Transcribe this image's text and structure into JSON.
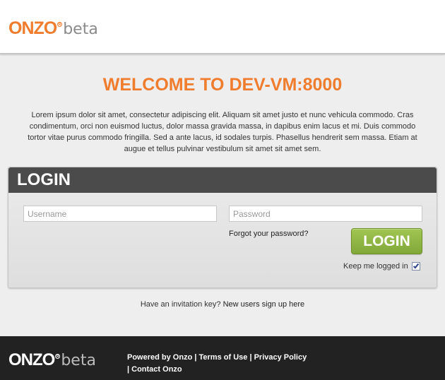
{
  "header": {
    "logo": {
      "brand": "ONZO",
      "reg": "R",
      "beta": "beta"
    }
  },
  "welcome": {
    "title": "WELCOME TO DEV-VM:8000",
    "intro": "Lorem ipsum dolor sit amet, consectetur adipiscing elit. Aliquam sit amet justo et nunc vehicula commodo. Cras condimentum, orci non euismod luctus, dolor massa gravida massa, in dapibus enim lacus et mi. Duis commodo tortor vitae purus commodo fringilla. Sed a ante lacus, id sodales turpis. Phasellus hendrerit sem massa. Etiam at augue et tellus pulvinar vestibulum sit amet sit amet sem."
  },
  "login": {
    "title": "LOGIN",
    "username": {
      "placeholder": "Username",
      "value": ""
    },
    "password": {
      "placeholder": "Password",
      "value": ""
    },
    "forgot_label": "Forgot your password?",
    "button_label": "LOGIN",
    "keep_logged_in_label": "Keep me logged in",
    "keep_logged_in_checked": true
  },
  "invite": {
    "prompt": "Have an invitation key?",
    "link_label": "New users sign up here"
  },
  "footer": {
    "logo": {
      "brand": "ONZO",
      "reg": "R",
      "beta": "beta"
    },
    "powered_by": "Powered by Onzo",
    "separator": "|",
    "terms_label": "Terms of Use",
    "privacy_label": "Privacy Policy",
    "contact_label": "Contact Onzo"
  },
  "colors": {
    "accent_orange": "#f07c2e",
    "login_green": "#8db446",
    "panel_header": "#4b4b4b",
    "footer_bg": "#222222"
  },
  "icons": {
    "checkbox": "checkmark-icon"
  }
}
